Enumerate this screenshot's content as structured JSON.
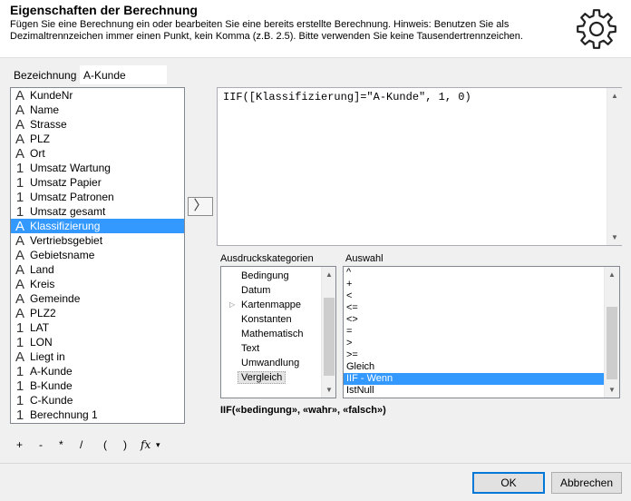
{
  "header": {
    "title": "Eigenschaften der Berechnung",
    "hint": "Fügen Sie eine Berechnung ein oder bearbeiten Sie eine bereits erstellte Berechnung. Hinweis: Benutzen Sie als Dezimaltrennzeichen immer einen Punkt, kein Komma (z.B. 2.5). Bitte verwenden Sie keine Tausendertrennzeichen.",
    "icon": "gear-icon"
  },
  "name": {
    "label": "Bezeichnung",
    "value": "A-Kunde"
  },
  "fields": [
    {
      "type": "A",
      "label": "KundeNr"
    },
    {
      "type": "A",
      "label": "Name"
    },
    {
      "type": "A",
      "label": "Strasse"
    },
    {
      "type": "A",
      "label": "PLZ"
    },
    {
      "type": "A",
      "label": "Ort"
    },
    {
      "type": "1",
      "label": "Umsatz Wartung"
    },
    {
      "type": "1",
      "label": "Umsatz Papier"
    },
    {
      "type": "1",
      "label": "Umsatz Patronen"
    },
    {
      "type": "1",
      "label": "Umsatz gesamt"
    },
    {
      "type": "A",
      "label": "Klassifizierung",
      "selected": true
    },
    {
      "type": "A",
      "label": "Vertriebsgebiet"
    },
    {
      "type": "A",
      "label": "Gebietsname"
    },
    {
      "type": "A",
      "label": "Land"
    },
    {
      "type": "A",
      "label": "Kreis"
    },
    {
      "type": "A",
      "label": "Gemeinde"
    },
    {
      "type": "A",
      "label": "PLZ2"
    },
    {
      "type": "1",
      "label": "LAT"
    },
    {
      "type": "1",
      "label": "LON"
    },
    {
      "type": "A",
      "label": "Liegt in"
    },
    {
      "type": "1",
      "label": "A-Kunde"
    },
    {
      "type": "1",
      "label": "B-Kunde"
    },
    {
      "type": "1",
      "label": "C-Kunde"
    },
    {
      "type": "1",
      "label": "Berechnung 1"
    }
  ],
  "insert_button": {
    "glyph": "〉"
  },
  "expression": "IIF([Klassifizierung]=\"A-Kunde\", 1, 0)",
  "categories": {
    "label": "Ausdruckskategorien",
    "items": [
      {
        "label": "Bedingung"
      },
      {
        "label": "Datum"
      },
      {
        "label": "Kartenmappe",
        "expandable": true
      },
      {
        "label": "Konstanten"
      },
      {
        "label": "Mathematisch"
      },
      {
        "label": "Text"
      },
      {
        "label": "Umwandlung"
      },
      {
        "label": "Vergleich",
        "selected": true
      }
    ]
  },
  "selection": {
    "label": "Auswahl",
    "items": [
      {
        "label": "^"
      },
      {
        "label": "+"
      },
      {
        "label": "<"
      },
      {
        "label": "<="
      },
      {
        "label": "<>"
      },
      {
        "label": "="
      },
      {
        "label": ">"
      },
      {
        "label": ">="
      },
      {
        "label": "Gleich"
      },
      {
        "label": "IIF - Wenn",
        "selected": true
      },
      {
        "label": "IstNull"
      }
    ]
  },
  "syntax": "IIF(«bedingung», «wahr», «falsch»)",
  "operators": [
    "+",
    "-",
    "*",
    "/",
    "(",
    ")",
    "fx",
    "▾"
  ],
  "buttons": {
    "ok": "OK",
    "cancel": "Abbrechen"
  },
  "colors": {
    "selection": "#3399ff",
    "ok_border": "#0078d7"
  }
}
